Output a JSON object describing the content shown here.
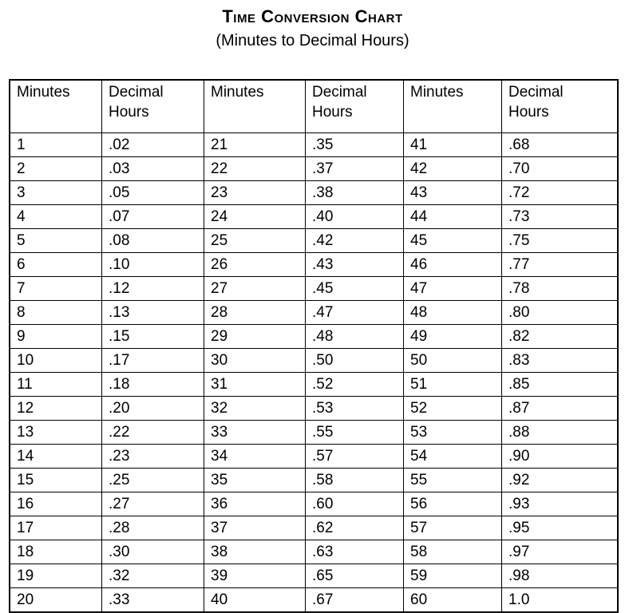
{
  "document": {
    "title": "Time Conversion Chart",
    "subtitle": "(Minutes to Decimal Hours)"
  },
  "table": {
    "headers": [
      {
        "line1": "Minutes",
        "line2": ""
      },
      {
        "line1": "Decimal",
        "line2": "Hours"
      },
      {
        "line1": "Minutes",
        "line2": ""
      },
      {
        "line1": "Decimal",
        "line2": "Hours"
      },
      {
        "line1": "Minutes",
        "line2": ""
      },
      {
        "line1": "Decimal",
        "line2": "Hours"
      }
    ],
    "rows": [
      {
        "m1": "1",
        "d1": ".02",
        "m2": "21",
        "d2": ".35",
        "m3": "41",
        "d3": ".68"
      },
      {
        "m1": "2",
        "d1": ".03",
        "m2": "22",
        "d2": ".37",
        "m3": "42",
        "d3": ".70"
      },
      {
        "m1": "3",
        "d1": ".05",
        "m2": "23",
        "d2": ".38",
        "m3": "43",
        "d3": ".72"
      },
      {
        "m1": "4",
        "d1": ".07",
        "m2": "24",
        "d2": ".40",
        "m3": "44",
        "d3": ".73"
      },
      {
        "m1": "5",
        "d1": ".08",
        "m2": "25",
        "d2": ".42",
        "m3": "45",
        "d3": ".75"
      },
      {
        "m1": "6",
        "d1": ".10",
        "m2": "26",
        "d2": ".43",
        "m3": "46",
        "d3": ".77"
      },
      {
        "m1": "7",
        "d1": ".12",
        "m2": "27",
        "d2": ".45",
        "m3": "47",
        "d3": ".78"
      },
      {
        "m1": "8",
        "d1": ".13",
        "m2": "28",
        "d2": ".47",
        "m3": "48",
        "d3": ".80"
      },
      {
        "m1": "9",
        "d1": ".15",
        "m2": "29",
        "d2": ".48",
        "m3": "49",
        "d3": ".82"
      },
      {
        "m1": "10",
        "d1": ".17",
        "m2": "30",
        "d2": ".50",
        "m3": "50",
        "d3": ".83"
      },
      {
        "m1": "11",
        "d1": ".18",
        "m2": "31",
        "d2": ".52",
        "m3": "51",
        "d3": ".85"
      },
      {
        "m1": "12",
        "d1": ".20",
        "m2": "32",
        "d2": ".53",
        "m3": "52",
        "d3": ".87"
      },
      {
        "m1": "13",
        "d1": ".22",
        "m2": "33",
        "d2": ".55",
        "m3": "53",
        "d3": ".88"
      },
      {
        "m1": "14",
        "d1": ".23",
        "m2": "34",
        "d2": ".57",
        "m3": "54",
        "d3": ".90"
      },
      {
        "m1": "15",
        "d1": ".25",
        "m2": "35",
        "d2": ".58",
        "m3": "55",
        "d3": ".92"
      },
      {
        "m1": "16",
        "d1": ".27",
        "m2": "36",
        "d2": ".60",
        "m3": "56",
        "d3": ".93"
      },
      {
        "m1": "17",
        "d1": ".28",
        "m2": "37",
        "d2": ".62",
        "m3": "57",
        "d3": ".95"
      },
      {
        "m1": "18",
        "d1": ".30",
        "m2": "38",
        "d2": ".63",
        "m3": "58",
        "d3": ".97"
      },
      {
        "m1": "19",
        "d1": ".32",
        "m2": "39",
        "d2": ".65",
        "m3": "59",
        "d3": ".98"
      },
      {
        "m1": "20",
        "d1": ".33",
        "m2": "40",
        "d2": ".67",
        "m3": "60",
        "d3": "1.0"
      }
    ]
  },
  "chart_data": {
    "type": "table",
    "title": "Time Conversion Chart",
    "subtitle": "(Minutes to Decimal Hours)",
    "columns": [
      "Minutes",
      "Decimal Hours",
      "Minutes",
      "Decimal Hours",
      "Minutes",
      "Decimal Hours"
    ],
    "minutes": [
      1,
      2,
      3,
      4,
      5,
      6,
      7,
      8,
      9,
      10,
      11,
      12,
      13,
      14,
      15,
      16,
      17,
      18,
      19,
      20,
      21,
      22,
      23,
      24,
      25,
      26,
      27,
      28,
      29,
      30,
      31,
      32,
      33,
      34,
      35,
      36,
      37,
      38,
      39,
      40,
      41,
      42,
      43,
      44,
      45,
      46,
      47,
      48,
      49,
      50,
      51,
      52,
      53,
      54,
      55,
      56,
      57,
      58,
      59,
      60
    ],
    "decimal_hours": [
      ".02",
      ".03",
      ".05",
      ".07",
      ".08",
      ".10",
      ".12",
      ".13",
      ".15",
      ".17",
      ".18",
      ".20",
      ".22",
      ".23",
      ".25",
      ".27",
      ".28",
      ".30",
      ".32",
      ".33",
      ".35",
      ".37",
      ".38",
      ".40",
      ".42",
      ".43",
      ".45",
      ".47",
      ".48",
      ".50",
      ".52",
      ".53",
      ".55",
      ".57",
      ".58",
      ".60",
      ".62",
      ".63",
      ".65",
      ".67",
      ".68",
      ".70",
      ".72",
      ".73",
      ".75",
      ".77",
      ".78",
      ".80",
      ".82",
      ".83",
      ".85",
      ".87",
      ".88",
      ".90",
      ".92",
      ".93",
      ".95",
      ".97",
      ".98",
      "1.0"
    ]
  },
  "colors": {
    "text": "#000000",
    "background": "#ffffff",
    "border": "#000000"
  }
}
